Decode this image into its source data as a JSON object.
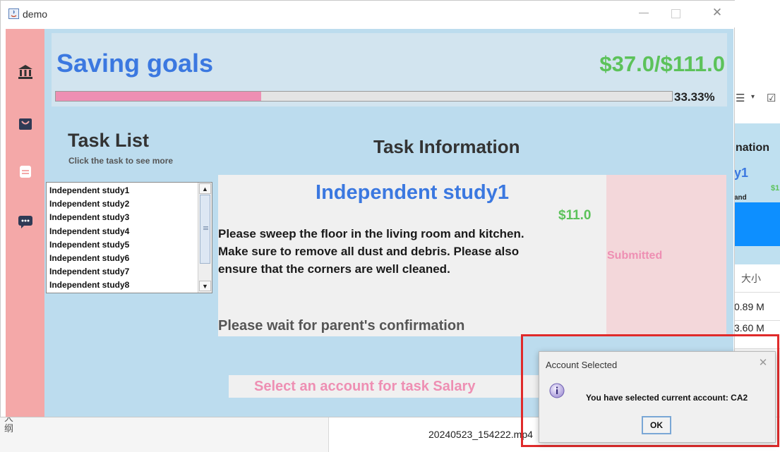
{
  "background_app": {
    "toolbar_icons": [
      "list-icon",
      "chevron-down-icon",
      "checkbox-icon"
    ],
    "panel_title_partial": "nation",
    "task_title_partial": "y1",
    "task_money_partial": "$1",
    "task_desc_partial": "and",
    "column_header": "大小",
    "file_sizes": [
      "0.89 M",
      "3.60 M"
    ],
    "file_name": "20240523_154222.mp4",
    "left_label": "大\n纲"
  },
  "window": {
    "title": "demo",
    "controls": [
      "minimize",
      "maximize",
      "close"
    ]
  },
  "sidebar": {
    "icons": [
      "bank-icon",
      "shopping-bag-icon",
      "clipboard-icon",
      "chat-icon"
    ]
  },
  "savings": {
    "title": "Saving goals",
    "amount": "$37.0/$111.0",
    "progress_percent": 33.33,
    "progress_label": "33.33%"
  },
  "task_list": {
    "title": "Task List",
    "subtitle": "Click the task to see more",
    "items": [
      "Independent study1",
      "Independent study2",
      "Independent study3",
      "Independent study4",
      "Independent study5",
      "Independent study6",
      "Independent study7",
      "Independent study8"
    ]
  },
  "task_info": {
    "header": "Task Information",
    "task_title": "Independent study1",
    "amount": "$11.0",
    "description": "Please sweep the floor in the living room and kitchen. Make sure to remove all dust and debris. Please also ensure that the corners are well cleaned.",
    "wait_message": "Please wait for parent's confirmation",
    "status": "Submitted"
  },
  "account_select": {
    "label": "Select an account for task Salary"
  },
  "dialog": {
    "title": "Account Selected",
    "message": "You have selected current account: CA2",
    "ok_label": "OK",
    "icon": "info-icon"
  },
  "colors": {
    "accent_blue": "#3b78e0",
    "money_green": "#5cc25a",
    "pink": "#ee8fb3",
    "sidebar": "#f4a8a8",
    "content_bg": "#bcdcee",
    "highlight_red": "#e02a2a"
  }
}
